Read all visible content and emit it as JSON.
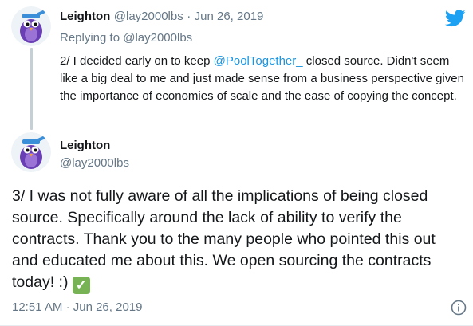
{
  "parent_tweet": {
    "author_name": "Leighton",
    "author_handle": "@lay2000lbs",
    "separator": "·",
    "date": "Jun 26, 2019",
    "replying_prefix": "Replying to",
    "replying_handle": "@lay2000lbs",
    "text_before_mention": "2/ I decided early on to keep ",
    "mention": "@PoolTogether_",
    "text_after_mention": " closed source. Didn't seem like a big deal to me and just made sense from a business perspective given the importance of economies of scale and the ease of copying the concept."
  },
  "main_tweet": {
    "author_name": "Leighton",
    "author_handle": "@lay2000lbs",
    "text": "3/ I was not fully aware of all the implications of being closed source. Specifically around the lack of ability to verify the contracts. Thank you to the many people who pointed this out and educated me about this. We open sourcing the contracts today! :)",
    "emoji": "✓",
    "time": "12:51 AM",
    "separator": "·",
    "date": "Jun 26, 2019"
  },
  "icons": {
    "brand": "twitter-bird-icon",
    "info": "info-icon",
    "avatar": "purple-bird-avatar"
  },
  "colors": {
    "accent": "#1b95e0",
    "twitter_blue": "#1da1f2",
    "secondary_text": "#657786",
    "thread_line": "#c4cfd6",
    "avatar_purple": "#6a3fb5",
    "check_green": "#77b255"
  }
}
